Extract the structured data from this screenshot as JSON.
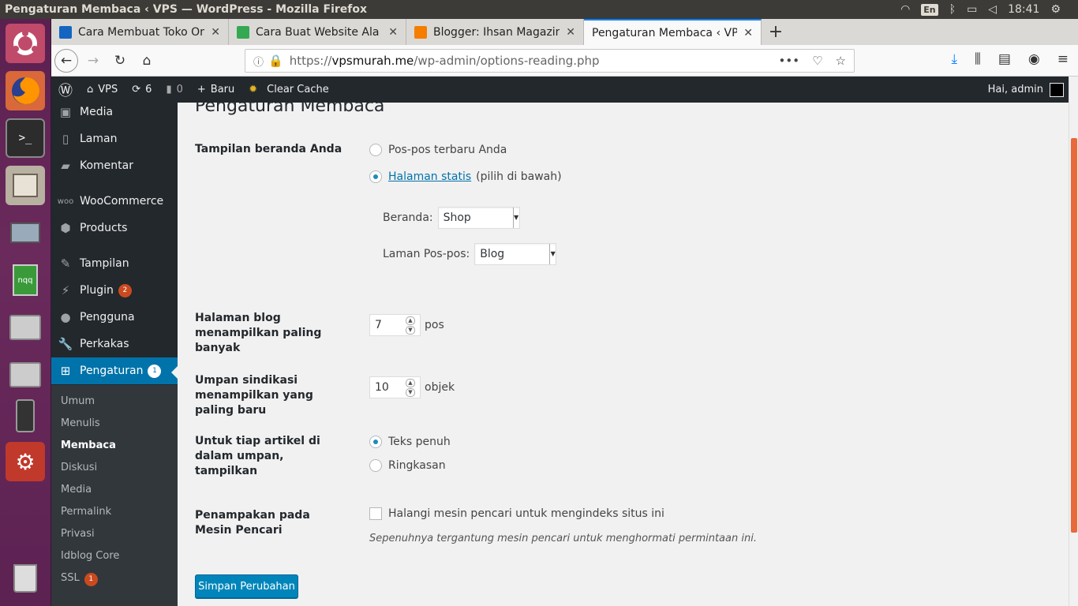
{
  "window": {
    "title": "Pengaturan Membaca ‹ VPS — WordPress - Mozilla Firefox"
  },
  "tray": {
    "lang": "En",
    "time": "18:41"
  },
  "tabs": [
    {
      "label": "Cara Membuat Toko Onl",
      "color": "#1565c0"
    },
    {
      "label": "Cara Buat Website Ala I",
      "color": "#34a853"
    },
    {
      "label": "Blogger: Ihsan Magazine",
      "color": "#f57d00"
    },
    {
      "label": "Pengaturan Membaca ‹ VPS",
      "color": ""
    }
  ],
  "address": {
    "scheme": "https://",
    "domain": "vpsmurah.me",
    "path": "/wp-admin/options-reading.php"
  },
  "adminbar": {
    "site": "VPS",
    "updates": "6",
    "comments": "0",
    "new": "Baru",
    "cache": "Clear Cache",
    "greeting": "Hai, admin"
  },
  "menu": [
    {
      "label": "Media",
      "icon": "media-icon"
    },
    {
      "label": "Laman",
      "icon": "page-icon"
    },
    {
      "label": "Komentar",
      "icon": "comment-icon"
    },
    {
      "label": "WooCommerce",
      "icon": "woo-icon"
    },
    {
      "label": "Products",
      "icon": "box-icon"
    },
    {
      "label": "Tampilan",
      "icon": "brush-icon"
    },
    {
      "label": "Plugin",
      "icon": "plugin-icon",
      "badge": "2"
    },
    {
      "label": "Pengguna",
      "icon": "user-icon"
    },
    {
      "label": "Perkakas",
      "icon": "wrench-icon"
    },
    {
      "label": "Pengaturan",
      "icon": "settings-icon",
      "badge": "1"
    }
  ],
  "submenu": [
    "Umum",
    "Menulis",
    "Membaca",
    "Diskusi",
    "Media",
    "Permalink",
    "Privasi",
    "Idblog Core",
    "SSL"
  ],
  "ssl_badge": "1",
  "page": {
    "title": "Pengaturan Membaca",
    "front_label": "Tampilan beranda Anda",
    "front_opt1": "Pos-pos terbaru Anda",
    "front_opt2_link": "Halaman statis",
    "front_opt2_rest": "(pilih di bawah)",
    "home_label": "Beranda:",
    "home_value": "Shop",
    "posts_label": "Laman Pos-pos:",
    "posts_value": "Blog",
    "blog_label": "Halaman blog menampilkan paling banyak",
    "blog_value": "7",
    "blog_unit": "pos",
    "feed_label": "Umpan sindikasi menampilkan yang paling baru",
    "feed_value": "10",
    "feed_unit": "objek",
    "article_label": "Untuk tiap artikel di dalam umpan, tampilkan",
    "article_opt1": "Teks penuh",
    "article_opt2": "Ringkasan",
    "search_label": "Penampakan pada Mesin Pencari",
    "search_opt": "Halangi mesin pencari untuk mengindeks situs ini",
    "search_desc": "Sepenuhnya tergantung mesin pencari untuk menghormati permintaan ini.",
    "save": "Simpan Perubahan"
  }
}
